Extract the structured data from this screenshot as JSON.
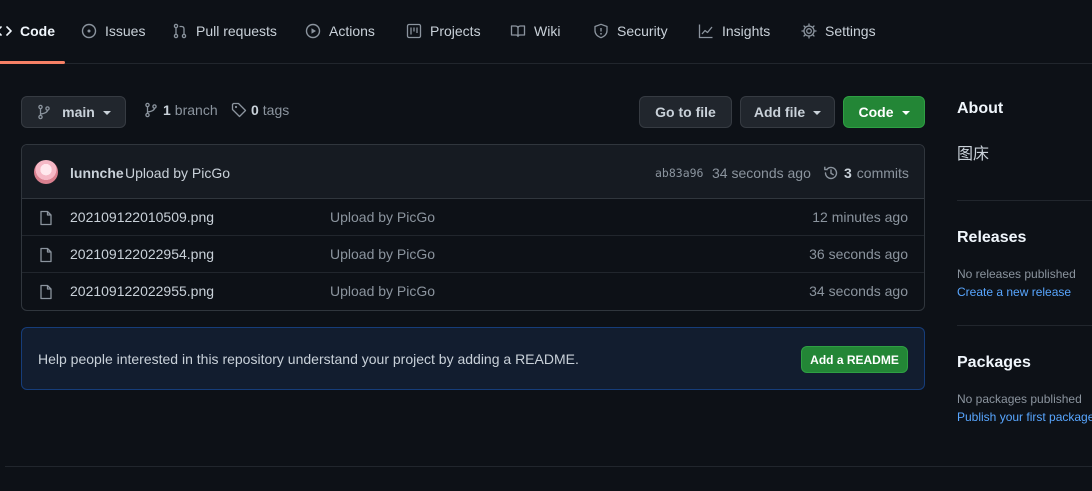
{
  "nav": {
    "tabs": [
      {
        "label": "Code",
        "icon": "code-icon"
      },
      {
        "label": "Issues",
        "icon": "issue-icon"
      },
      {
        "label": "Pull requests",
        "icon": "pull-request-icon"
      },
      {
        "label": "Actions",
        "icon": "play-icon"
      },
      {
        "label": "Projects",
        "icon": "project-icon"
      },
      {
        "label": "Wiki",
        "icon": "book-icon"
      },
      {
        "label": "Security",
        "icon": "shield-icon"
      },
      {
        "label": "Insights",
        "icon": "graph-icon"
      },
      {
        "label": "Settings",
        "icon": "gear-icon"
      }
    ],
    "active_tab": "Code"
  },
  "toolbar": {
    "branch_name": "main",
    "branch_count": "1",
    "branch_label": "branch",
    "tag_count": "0",
    "tag_label": "tags",
    "go_to_file": "Go to file",
    "add_file": "Add file",
    "code_button": "Code"
  },
  "latest_commit": {
    "author": "lunnche",
    "message": "Upload by PicGo",
    "sha": "ab83a96",
    "time": "34 seconds ago",
    "commit_count": "3",
    "commit_label": "commits"
  },
  "files": [
    {
      "name": "202109122010509.png",
      "message": "Upload by PicGo",
      "time": "12 minutes ago"
    },
    {
      "name": "202109122022954.png",
      "message": "Upload by PicGo",
      "time": "36 seconds ago"
    },
    {
      "name": "202109122022955.png",
      "message": "Upload by PicGo",
      "time": "34 seconds ago"
    }
  ],
  "readme": {
    "text": "Help people interested in this repository understand your project by adding a README.",
    "button": "Add a README"
  },
  "sidebar": {
    "about_heading": "About",
    "about_description": "图床",
    "releases_heading": "Releases",
    "releases_text": "No releases published",
    "releases_link": "Create a new release",
    "packages_heading": "Packages",
    "packages_text": "No packages published",
    "packages_link": "Publish your first package"
  },
  "colors": {
    "background": "#0d1117",
    "accent_underline": "#f78166",
    "primary_button": "#238636",
    "link": "#58a6ff"
  }
}
